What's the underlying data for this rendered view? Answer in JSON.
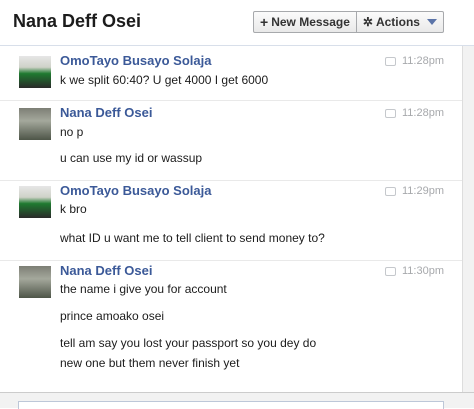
{
  "header": {
    "title": "Nana Deff Osei",
    "new_message_label": "New Message",
    "actions_label": "Actions"
  },
  "messages": [
    {
      "sender": "OmoTayo Busayo Solaja",
      "time": "11:28pm",
      "lines": [
        "k we split 60:40? U get 4000 I get 6000"
      ]
    },
    {
      "sender": "Nana Deff Osei",
      "time": "11:28pm",
      "lines": [
        "no p",
        "u can use my id or wassup"
      ]
    },
    {
      "sender": "OmoTayo Busayo Solaja",
      "time": "11:29pm",
      "lines": [
        "k bro",
        "what ID u want me to tell client to send money to?"
      ]
    },
    {
      "sender": "Nana Deff Osei",
      "time": "11:30pm",
      "lines": [
        "the name i give you for account",
        "prince amoako osei",
        "tell am say you lost your passport so you dey do",
        "new one but them never finish yet"
      ]
    }
  ],
  "icons": {
    "new_message": "plus-icon",
    "actions": "gear-icon",
    "actions_dropdown": "chevron-down-icon",
    "timestamp": "chat-bubble-icon"
  },
  "colors": {
    "sender": "#3b5998",
    "timestamp": "#a7a9ac",
    "text": "#1c1c1c"
  }
}
